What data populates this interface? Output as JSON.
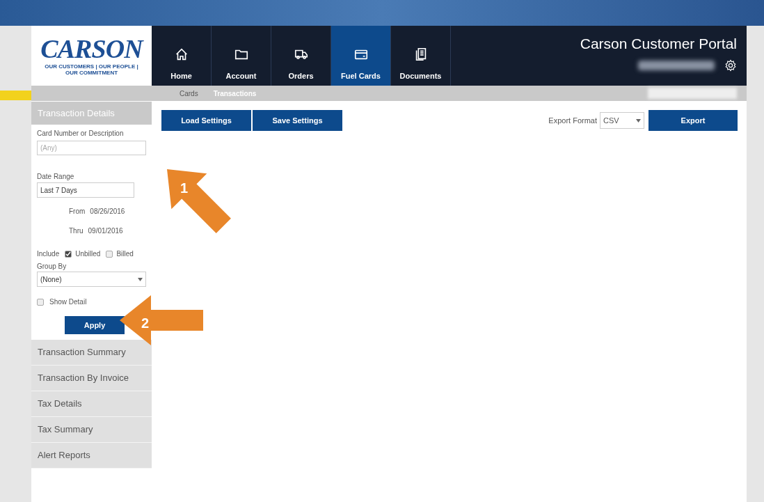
{
  "logo": {
    "name": "CARSON",
    "tagline": "OUR CUSTOMERS | OUR PEOPLE | OUR COMMITMENT"
  },
  "nav_tabs": [
    {
      "label": "Home",
      "kind": "home",
      "selected": false
    },
    {
      "label": "Account",
      "kind": "folder",
      "selected": false
    },
    {
      "label": "Orders",
      "kind": "truck",
      "selected": false
    },
    {
      "label": "Fuel Cards",
      "kind": "card",
      "selected": true
    },
    {
      "label": "Documents",
      "kind": "documents",
      "selected": false
    }
  ],
  "portal_title": "Carson Customer Portal",
  "sub_tabs": [
    {
      "label": "Cards",
      "selected": false
    },
    {
      "label": "Transactions",
      "selected": true
    }
  ],
  "sidebar": {
    "active_section": "Transaction Details",
    "card_field": {
      "label": "Card Number or Description",
      "placeholder": "(Any)"
    },
    "date_range": {
      "label": "Date Range",
      "value": "Last 7 Days",
      "from_label": "From",
      "from": "08/26/2016",
      "thru_label": "Thru",
      "thru": "09/01/2016"
    },
    "include": {
      "label": "Include",
      "options": [
        {
          "label": "Unbilled",
          "checked": true
        },
        {
          "label": "Billed",
          "checked": false
        }
      ]
    },
    "group_by": {
      "label": "Group By",
      "value": "(None)"
    },
    "show_detail": {
      "label": "Show Detail",
      "checked": false
    },
    "apply": "Apply",
    "sections": [
      "Transaction Summary",
      "Transaction By Invoice",
      "Tax Details",
      "Tax Summary",
      "Alert Reports"
    ]
  },
  "toolbar": {
    "buttons": [
      "Load Settings",
      "Save Settings"
    ],
    "export_format_label": "Export Format",
    "export_format": "CSV",
    "export_button": "Export"
  },
  "annotations": [
    {
      "number": "1"
    },
    {
      "number": "2"
    }
  ]
}
